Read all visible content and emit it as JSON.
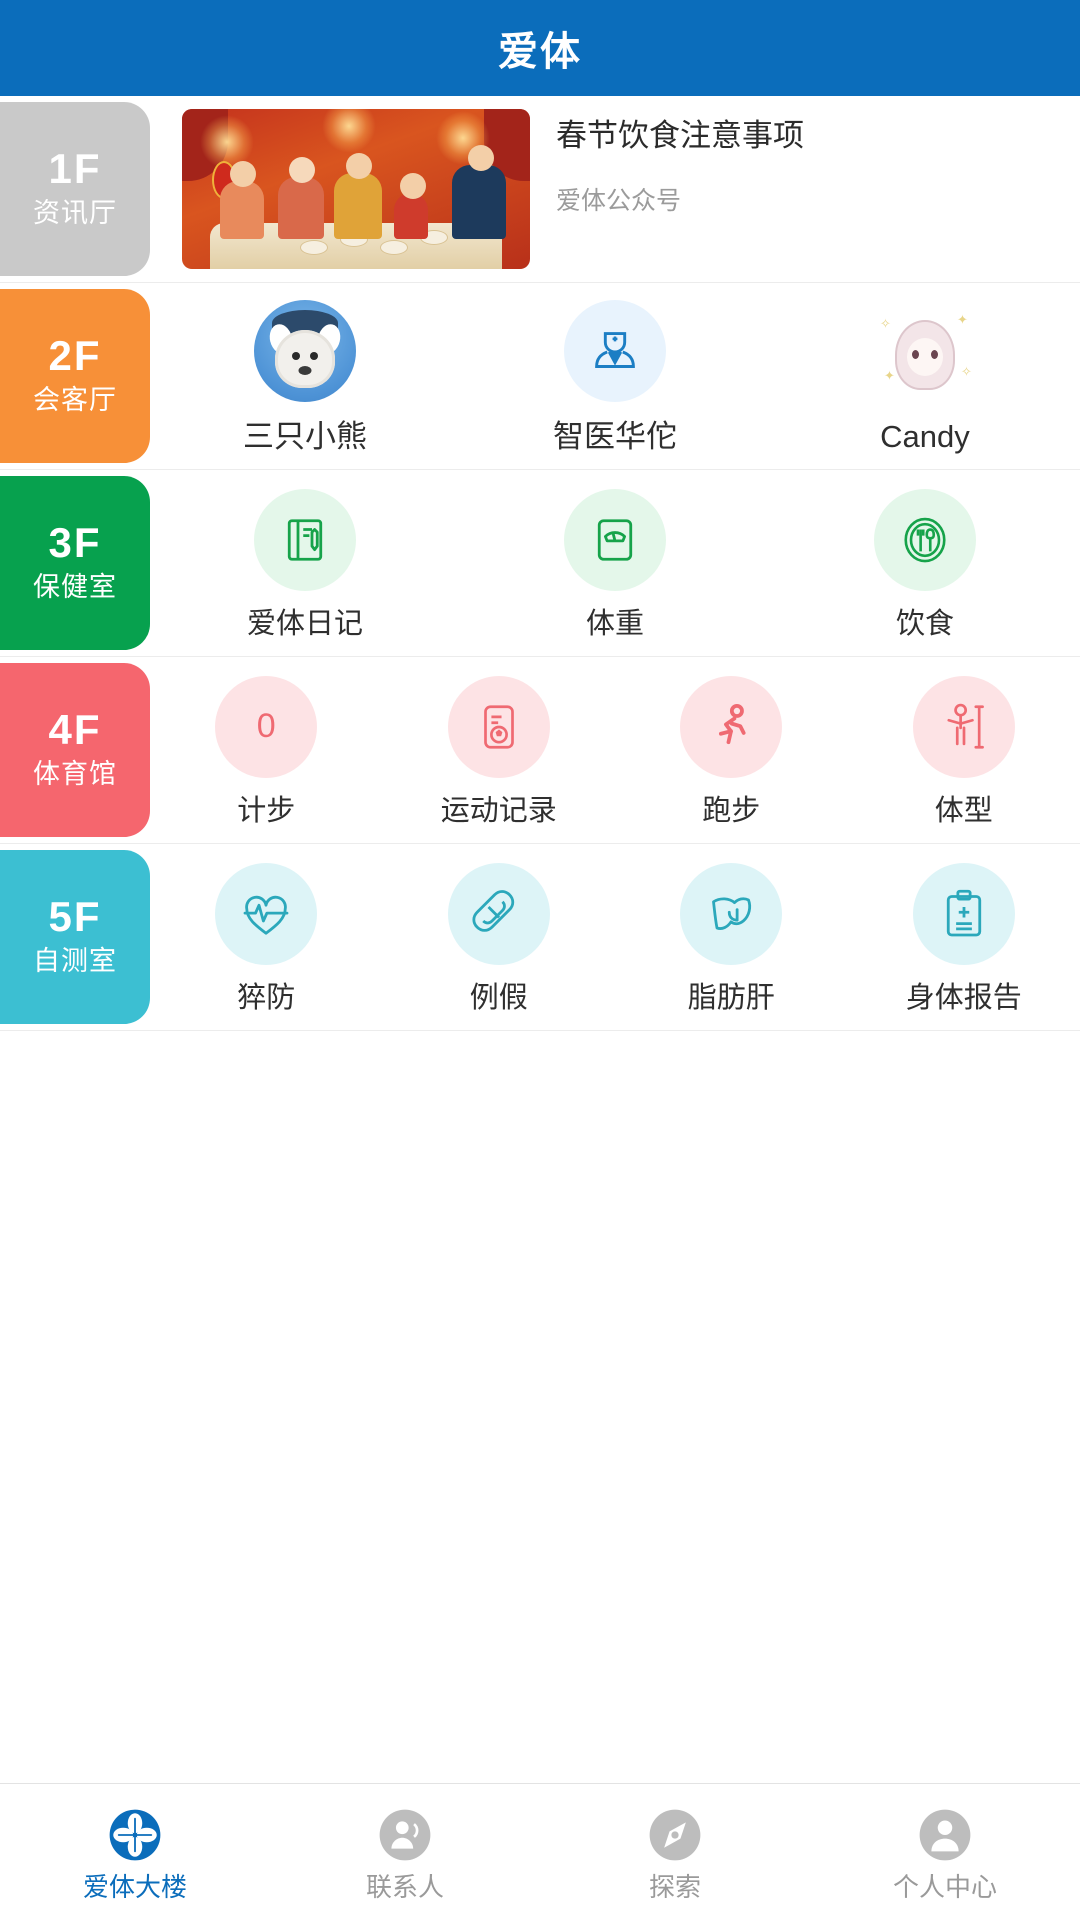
{
  "header": {
    "title": "爱体"
  },
  "colors": {
    "brand": "#0b6dbb",
    "floor1": "#c9c9c9",
    "floor2": "#f79038",
    "floor3": "#07a14e",
    "floor4": "#f5666e",
    "floor5": "#3cbfd2",
    "active_tab": "#0b6dbb",
    "inactive_tab": "#9a9a9a"
  },
  "floors": [
    {
      "num": "1F",
      "name": "资讯厅",
      "news": {
        "title": "春节饮食注意事项",
        "source": "爱体公众号",
        "thumb_icon": "chinese-new-year-family-dinner-image"
      }
    },
    {
      "num": "2F",
      "name": "会客厅",
      "items": [
        {
          "label": "三只小熊",
          "icon": "dog-avatar"
        },
        {
          "label": "智医华佗",
          "icon": "doctor-icon"
        },
        {
          "label": "Candy",
          "icon": "anime-girl-avatar"
        }
      ]
    },
    {
      "num": "3F",
      "name": "保健室",
      "items": [
        {
          "label": "爱体日记",
          "icon": "notebook-pen-icon"
        },
        {
          "label": "体重",
          "icon": "weight-scale-icon"
        },
        {
          "label": "饮食",
          "icon": "fork-spoon-plate-icon"
        }
      ]
    },
    {
      "num": "4F",
      "name": "体育馆",
      "items": [
        {
          "label": "计步",
          "icon": "step-count-icon",
          "value": "0"
        },
        {
          "label": "运动记录",
          "icon": "sport-record-icon"
        },
        {
          "label": "跑步",
          "icon": "running-person-icon"
        },
        {
          "label": "体型",
          "icon": "body-shape-icon"
        }
      ]
    },
    {
      "num": "5F",
      "name": "自测室",
      "items": [
        {
          "label": "猝防",
          "icon": "heart-pulse-icon"
        },
        {
          "label": "例假",
          "icon": "sanitary-pad-icon"
        },
        {
          "label": "脂肪肝",
          "icon": "liver-icon"
        },
        {
          "label": "身体报告",
          "icon": "clipboard-plus-icon"
        }
      ]
    }
  ],
  "tabbar": [
    {
      "label": "爱体大楼",
      "icon": "building-flower-icon",
      "active": true
    },
    {
      "label": "联系人",
      "icon": "contacts-icon",
      "active": false
    },
    {
      "label": "探索",
      "icon": "compass-icon",
      "active": false
    },
    {
      "label": "个人中心",
      "icon": "person-icon",
      "active": false
    }
  ]
}
